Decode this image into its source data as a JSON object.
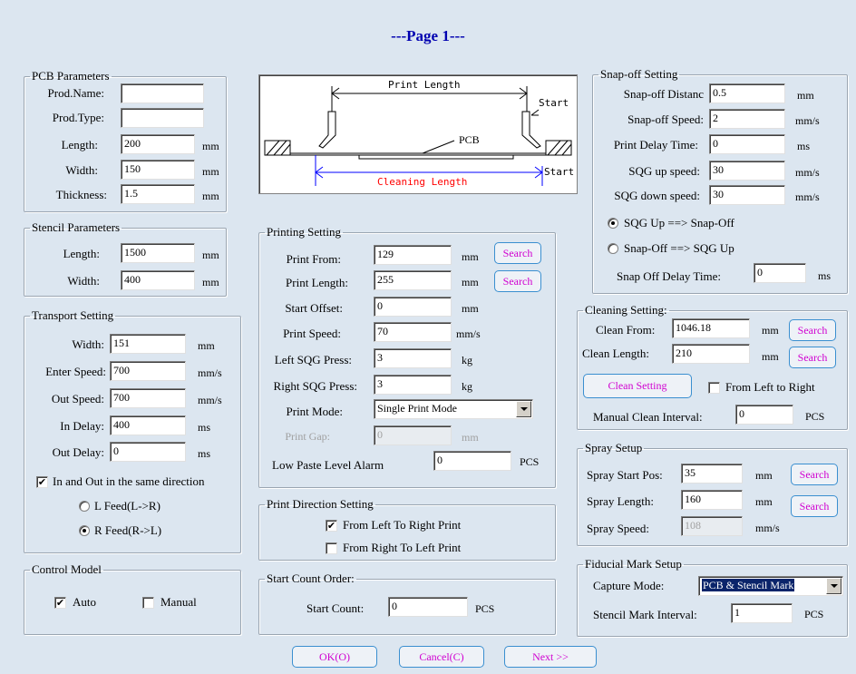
{
  "title": "---Page 1---",
  "pcb": {
    "legend": "PCB Parameters",
    "prod_name_label": "Prod.Name:",
    "prod_name": "",
    "prod_type_label": "Prod.Type:",
    "prod_type": "",
    "length_label": "Length:",
    "length": "200",
    "width_label": "Width:",
    "width": "150",
    "thickness_label": "Thickness:",
    "thickness": "1.5",
    "unit": "mm"
  },
  "stencil": {
    "legend": "Stencil Parameters",
    "length_label": "Length:",
    "length": "1500",
    "width_label": "Width:",
    "width": "400",
    "unit": "mm"
  },
  "transport": {
    "legend": "Transport Setting",
    "width_label": "Width:",
    "width": "151",
    "width_unit": "mm",
    "enter_speed_label": "Enter Speed:",
    "enter_speed": "700",
    "enter_speed_unit": "mm/s",
    "out_speed_label": "Out Speed:",
    "out_speed": "700",
    "out_speed_unit": "mm/s",
    "in_delay_label": "In Delay:",
    "in_delay": "400",
    "in_delay_unit": "ms",
    "out_delay_label": "Out Delay:",
    "out_delay": "0",
    "out_delay_unit": "ms",
    "same_direction_label": "In and Out in the same direction",
    "same_direction": true,
    "l_feed_label": "L Feed(L->R)",
    "r_feed_label": "R Feed(R->L)",
    "feed_selected": "R"
  },
  "control": {
    "legend": "Control Model",
    "auto_label": "Auto",
    "auto": true,
    "manual_label": "Manual",
    "manual": false
  },
  "diagram": {
    "print_length": "Print Length",
    "start_top": "Start",
    "pcb": "PCB",
    "cleaning_length": "Cleaning Length",
    "start_bottom": "Start",
    "blue": "#0000ff",
    "red": "#ff0000"
  },
  "printing": {
    "legend": "Printing Setting",
    "print_from_label": "Print From:",
    "print_from": "129",
    "print_from_unit": "mm",
    "print_length_label": "Print Length:",
    "print_length": "255",
    "print_length_unit": "mm",
    "start_offset_label": "Start Offset:",
    "start_offset": "0",
    "start_offset_unit": "mm",
    "print_speed_label": "Print Speed:",
    "print_speed": "70",
    "print_speed_unit": "mm/s",
    "left_sqg_label": "Left SQG Press:",
    "left_sqg": "3",
    "left_sqg_unit": "kg",
    "right_sqg_label": "Right SQG Press:",
    "right_sqg": "3",
    "right_sqg_unit": "kg",
    "print_mode_label": "Print Mode:",
    "print_mode": "Single Print Mode",
    "print_gap_label": "Print Gap:",
    "print_gap": "0",
    "print_gap_unit": "mm",
    "low_paste_label": "Low Paste Level Alarm",
    "low_paste": "0",
    "low_paste_unit": "PCS",
    "search": "Search"
  },
  "direction": {
    "legend": "Print Direction Setting",
    "ltr_label": "From Left To Right Print",
    "ltr": true,
    "rtl_label": "From Right To Left Print",
    "rtl": false
  },
  "count": {
    "legend": "Start Count Order:",
    "start_count_label": "Start Count:",
    "start_count": "0",
    "unit": "PCS"
  },
  "snapoff": {
    "legend": "Snap-off Setting",
    "distance_label": "Snap-off Distanc",
    "distance": "0.5",
    "distance_unit": "mm",
    "speed_label": "Snap-off Speed:",
    "speed": "2",
    "speed_unit": "mm/s",
    "print_delay_label": "Print Delay Time:",
    "print_delay": "0",
    "print_delay_unit": "ms",
    "sqg_up_label": "SQG up speed:",
    "sqg_up": "30",
    "sqg_up_unit": "mm/s",
    "sqg_down_label": "SQG down speed:",
    "sqg_down": "30",
    "sqg_down_unit": "mm/s",
    "option1_label": "SQG Up ==> Snap-Off",
    "option2_label": "Snap-Off ==> SQG Up",
    "selected": 1,
    "delay_label": "Snap Off Delay Time:",
    "delay": "0",
    "delay_unit": "ms"
  },
  "cleaning": {
    "legend": "Cleaning Setting:",
    "clean_from_label": "Clean From:",
    "clean_from": "1046.18",
    "clean_from_unit": "mm",
    "clean_length_label": "Clean Length:",
    "clean_length": "210",
    "clean_length_unit": "mm",
    "clean_setting_button": "Clean Setting",
    "ltr_label": "From Left to Right",
    "ltr": false,
    "interval_label": "Manual Clean Interval:",
    "interval": "0",
    "interval_unit": "PCS",
    "search": "Search"
  },
  "spray": {
    "legend": "Spray Setup",
    "start_pos_label": "Spray Start Pos:",
    "start_pos": "35",
    "start_pos_unit": "mm",
    "length_label": "Spray Length:",
    "length": "160",
    "length_unit": "mm",
    "speed_label": "Spray Speed:",
    "speed": "108",
    "speed_unit": "mm/s",
    "search": "Search"
  },
  "fiducial": {
    "legend": "Fiducial Mark Setup",
    "capture_label": "Capture Mode:",
    "capture": "PCB & Stencil Mark",
    "interval_label": "Stencil Mark Interval:",
    "interval": "1",
    "interval_unit": "PCS"
  },
  "footer": {
    "ok": "OK(O)",
    "cancel": "Cancel(C)",
    "next": "Next >>"
  }
}
